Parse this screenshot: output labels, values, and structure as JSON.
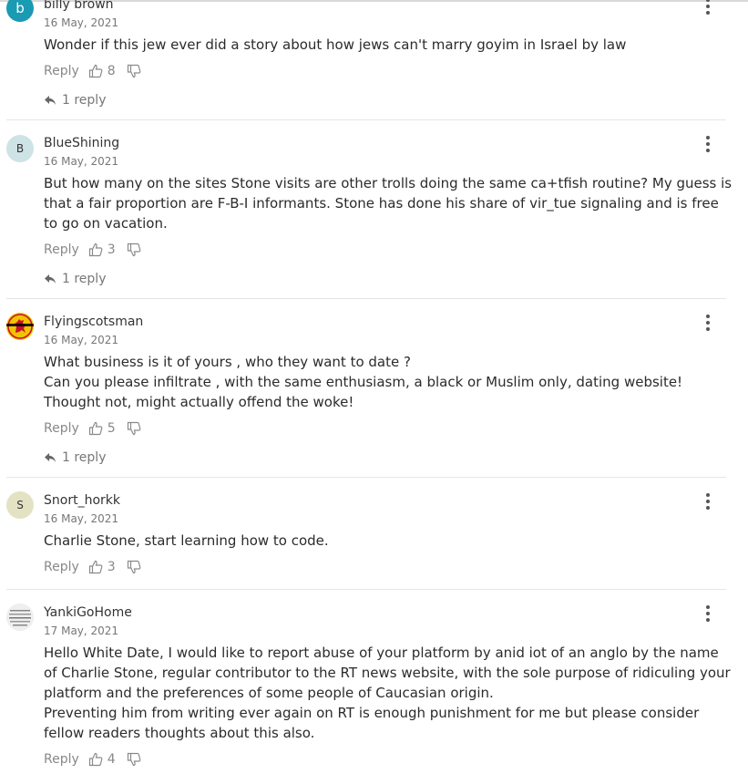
{
  "ui": {
    "reply_label": "Reply"
  },
  "comments": [
    {
      "author": "billy brown",
      "date": "16 May, 2021",
      "avatar_letter": "b",
      "avatar_color": "#1a9ab3",
      "lines": [
        "Wonder if this jew ever did a story about how jews can't marry goyim in Israel by law"
      ],
      "likes": "8",
      "replies": "1 reply"
    },
    {
      "author": "BlueShining",
      "date": "16 May, 2021",
      "avatar_letter": "B",
      "avatar_color": "#cde3e6",
      "lines": [
        "But how many on the sites Stone visits are other trolls doing the same ca+tfish routine?  My guess is",
        "that a fair proportion are F-B-I informants. Stone has done his share of vir_tue signaling and is free",
        "to go on vacation."
      ],
      "likes": "3",
      "replies": "1 reply"
    },
    {
      "author": "Flyingscotsman",
      "date": "16 May, 2021",
      "avatar_letter": "",
      "avatar_color": "#f2c400",
      "lines": [
        "What business is it of yours , who they want to date ?",
        "Can you please infiltrate , with the same enthusiasm, a black or Muslim only, dating website!",
        "Thought not, might actually offend the woke!"
      ],
      "likes": "5",
      "replies": "1 reply"
    },
    {
      "author": "Snort_horkk",
      "date": "16 May, 2021",
      "avatar_letter": "S",
      "avatar_color": "#e3e3c4",
      "lines": [
        "Charlie Stone, start learning how to code."
      ],
      "likes": "3",
      "replies": ""
    },
    {
      "author": "YankiGoHome",
      "date": "17 May, 2021",
      "avatar_letter": "",
      "avatar_color": "#e8e8e8",
      "lines": [
        "Hello White Date, I would like to report abuse of your platform by anid iot of an anglo by the name",
        "of Charlie Stone, regular contributor to the RT news website, with the sole purpose of ridiculing your",
        "platform and the preferences of some people of Caucasian origin.",
        "Preventing him from writing ever again on RT is enough punishment for me but please consider",
        "fellow readers thoughts about this also."
      ],
      "likes": "4",
      "replies": ""
    }
  ]
}
